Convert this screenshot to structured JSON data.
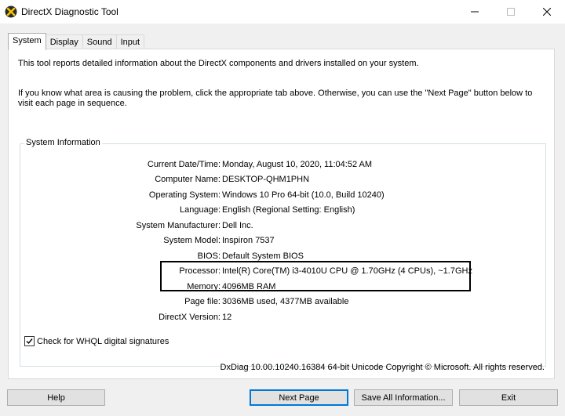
{
  "window": {
    "title": "DirectX Diagnostic Tool",
    "app_icon": "directx-x-icon"
  },
  "tabs": [
    {
      "label": "System",
      "active": true
    },
    {
      "label": "Display",
      "active": false
    },
    {
      "label": "Sound",
      "active": false
    },
    {
      "label": "Input",
      "active": false
    }
  ],
  "intro": {
    "line1": "This tool reports detailed information about the DirectX components and drivers installed on your system.",
    "line2": "If you know what area is causing the problem, click the appropriate tab above.  Otherwise, you can use the \"Next Page\" button below to visit each page in sequence."
  },
  "system_info": {
    "title": "System Information",
    "rows": [
      {
        "label": "Current Date/Time:",
        "value": "Monday, August 10, 2020, 11:04:52 AM"
      },
      {
        "label": "Computer Name:",
        "value": "DESKTOP-QHM1PHN"
      },
      {
        "label": "Operating System:",
        "value": "Windows 10 Pro 64-bit (10.0, Build 10240)"
      },
      {
        "label": "Language:",
        "value": "English (Regional Setting: English)"
      },
      {
        "label": "System Manufacturer:",
        "value": "Dell Inc."
      },
      {
        "label": "System Model:",
        "value": "Inspiron 7537"
      },
      {
        "label": "BIOS:",
        "value": "Default System BIOS"
      },
      {
        "label": "Processor:",
        "value": "Intel(R) Core(TM) i3-4010U CPU @ 1.70GHz (4 CPUs), ~1.7GHz"
      },
      {
        "label": "Memory:",
        "value": "4096MB RAM"
      },
      {
        "label": "Page file:",
        "value": "3036MB used, 4377MB available"
      },
      {
        "label": "DirectX Version:",
        "value": "12"
      }
    ]
  },
  "whql": {
    "label": "Check for WHQL digital signatures",
    "checked": true
  },
  "footer": "DxDiag 10.00.10240.16384 64-bit Unicode  Copyright © Microsoft. All rights reserved.",
  "buttons": {
    "help": "Help",
    "next_page": "Next Page",
    "save_all": "Save All Information...",
    "exit": "Exit"
  }
}
